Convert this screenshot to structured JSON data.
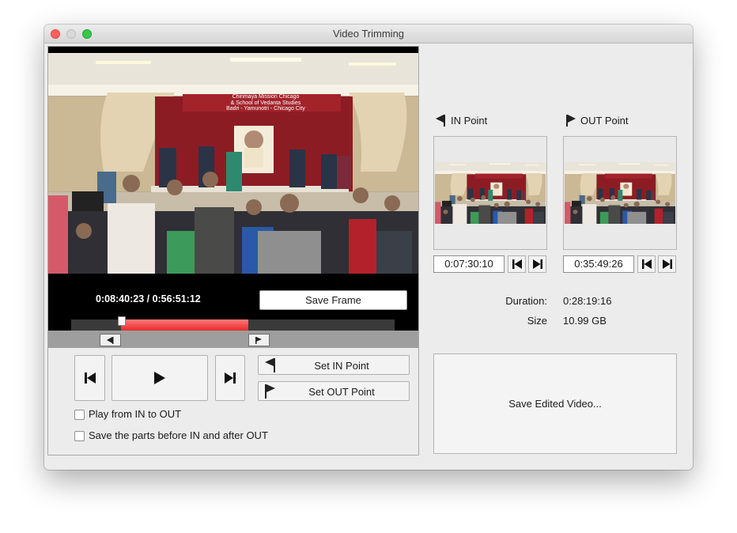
{
  "window": {
    "title": "Video Trimming"
  },
  "player": {
    "timecode": "0:08:40:23 / 0:56:51:12",
    "save_frame_label": "Save Frame",
    "banner_line1": "Chinmaya Mission Chicago",
    "banner_line2": "& School of Vedanta Studies",
    "banner_line3": "Badri - Yamunotri - Chicago City"
  },
  "timeline": {
    "in_fraction": 0.153,
    "out_fraction": 0.547,
    "playhead_fraction": 0.153
  },
  "transport": {
    "prev_icon": "skip-back-icon",
    "play_icon": "play-icon",
    "next_icon": "skip-forward-icon",
    "set_in_label": "Set IN Point",
    "set_out_label": "Set OUT Point"
  },
  "options": {
    "play_in_out": {
      "label": "Play from IN to OUT",
      "checked": false
    },
    "save_parts": {
      "label": "Save the parts before IN and after OUT",
      "checked": false
    }
  },
  "in_point": {
    "label": "IN Point",
    "timecode": "0:07:30:10"
  },
  "out_point": {
    "label": "OUT Point",
    "timecode": "0:35:49:26"
  },
  "info": {
    "duration_label": "Duration:",
    "duration_value": "0:28:19:16",
    "size_label": "Size",
    "size_value": "10.99 GB"
  },
  "save_edited_label": "Save Edited Video...",
  "colors": {
    "selection": "#e8292c",
    "curtain": "#8c1c24",
    "backdrop": "#d9c9a8"
  }
}
